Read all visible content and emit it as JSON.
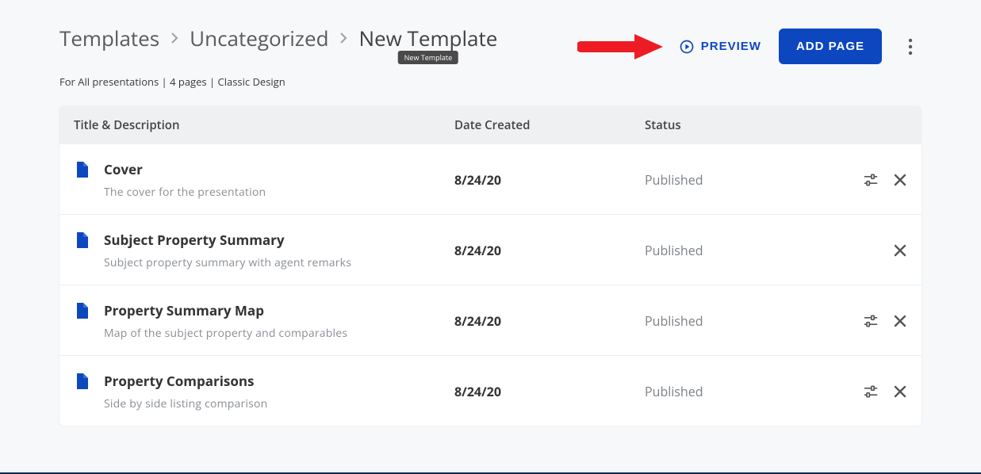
{
  "breadcrumb": {
    "root": "Templates",
    "category": "Uncategorized",
    "current": "New Template",
    "tooltip": "New Template"
  },
  "meta": "For All presentations | 4 pages | Classic Design",
  "actions": {
    "preview": "PREVIEW",
    "add_page": "ADD PAGE"
  },
  "columns": {
    "title": "Title & Description",
    "date": "Date Created",
    "status": "Status"
  },
  "rows": [
    {
      "title": "Cover",
      "desc": "The cover for the presentation",
      "date": "8/24/20",
      "status": "Published",
      "has_settings": true
    },
    {
      "title": "Subject Property Summary",
      "desc": "Subject property summary with agent remarks",
      "date": "8/24/20",
      "status": "Published",
      "has_settings": false
    },
    {
      "title": "Property Summary Map",
      "desc": "Map of the subject property and comparables",
      "date": "8/24/20",
      "status": "Published",
      "has_settings": true
    },
    {
      "title": "Property Comparisons",
      "desc": "Side by side listing comparison",
      "date": "8/24/20",
      "status": "Published",
      "has_settings": true
    }
  ]
}
